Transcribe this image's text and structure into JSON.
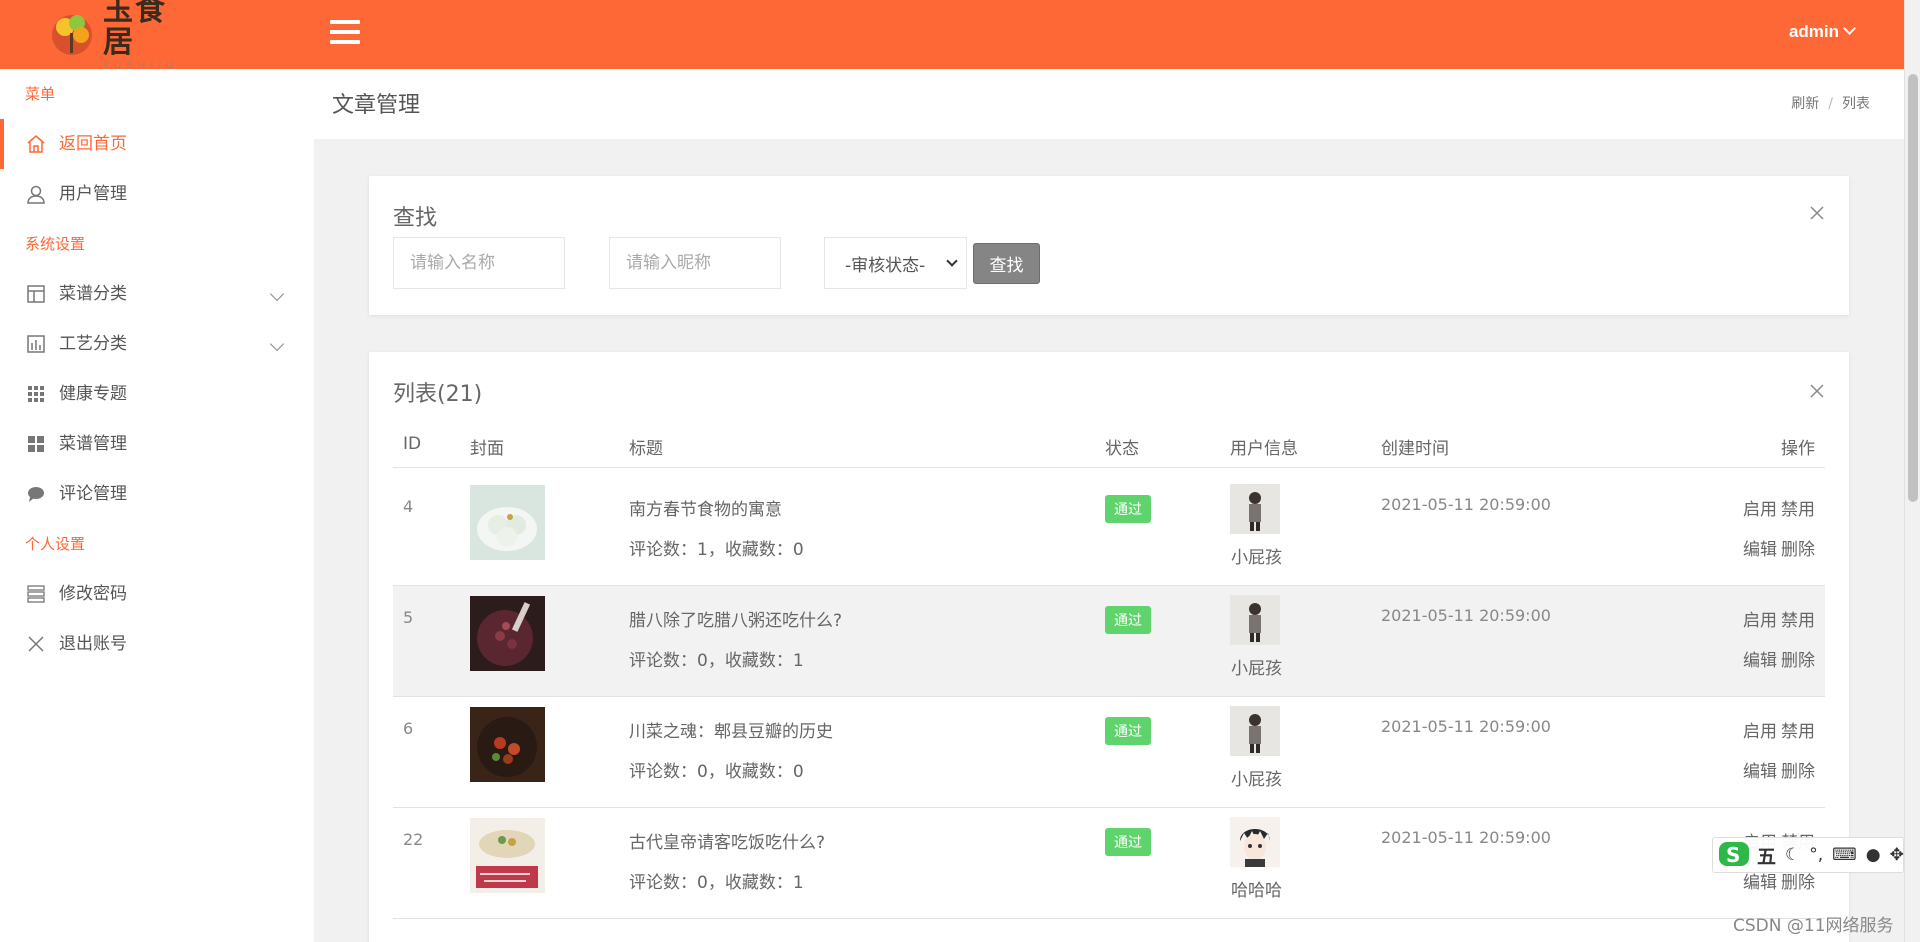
{
  "brand": {
    "name_cn": "玉食居",
    "name_en": "YUSHIJU"
  },
  "header": {
    "user": "admin"
  },
  "sidebar": {
    "groups": [
      {
        "title": "菜单",
        "items": [
          {
            "label": "返回首页",
            "icon": "home-icon",
            "active": true
          },
          {
            "label": "用户管理",
            "icon": "user-icon"
          }
        ]
      },
      {
        "title": "系统设置",
        "items": [
          {
            "label": "菜谱分类",
            "icon": "layout-icon",
            "expandable": true
          },
          {
            "label": "工艺分类",
            "icon": "chart-icon",
            "expandable": true
          },
          {
            "label": "健康专题",
            "icon": "grid-icon"
          },
          {
            "label": "菜谱管理",
            "icon": "app-grid-icon"
          },
          {
            "label": "评论管理",
            "icon": "comment-icon"
          }
        ]
      },
      {
        "title": "个人设置",
        "items": [
          {
            "label": "修改密码",
            "icon": "list-icon"
          },
          {
            "label": "退出账号",
            "icon": "close-icon"
          }
        ]
      }
    ]
  },
  "page": {
    "title": "文章管理",
    "breadcrumbs": [
      "刷新",
      "列表"
    ]
  },
  "search": {
    "title": "查找",
    "name_placeholder": "请输入名称",
    "nick_placeholder": "请输入昵称",
    "status_selected": "-审核状态-",
    "button": "查找"
  },
  "list": {
    "title": "列表(21)",
    "columns": [
      "ID",
      "封面",
      "标题",
      "状态",
      "用户信息",
      "创建时间",
      "操作"
    ],
    "rows": [
      {
        "id": "4",
        "title": "南方春节食物的寓意",
        "stats": "评论数：1，收藏数：0",
        "status": "通过",
        "user": "小屁孩",
        "time": "2021-05-11 20:59:00",
        "cover": "tangyuan",
        "avatar": "child"
      },
      {
        "id": "5",
        "title": "腊八除了吃腊八粥还吃什么?",
        "stats": "评论数：0，收藏数：1",
        "status": "通过",
        "user": "小屁孩",
        "time": "2021-05-11 20:59:00",
        "cover": "porridge",
        "avatar": "child"
      },
      {
        "id": "6",
        "title": "川菜之魂：郫县豆瓣的历史",
        "stats": "评论数：0，收藏数：0",
        "status": "通过",
        "user": "小屁孩",
        "time": "2021-05-11 20:59:00",
        "cover": "beans",
        "avatar": "child"
      },
      {
        "id": "22",
        "title": "古代皇帝请客吃饭吃什么?",
        "stats": "评论数：0，收藏数：1",
        "status": "通过",
        "user": "哈哈哈",
        "time": "2021-05-11 20:59:00",
        "cover": "banquet",
        "avatar": "anime"
      }
    ],
    "ops": {
      "enable": "启用",
      "disable": "禁用",
      "edit": "编辑",
      "delete": "删除"
    }
  },
  "ime": {
    "mode": "五",
    "punct": "°,"
  },
  "watermark": "CSDN @11网络服务"
}
